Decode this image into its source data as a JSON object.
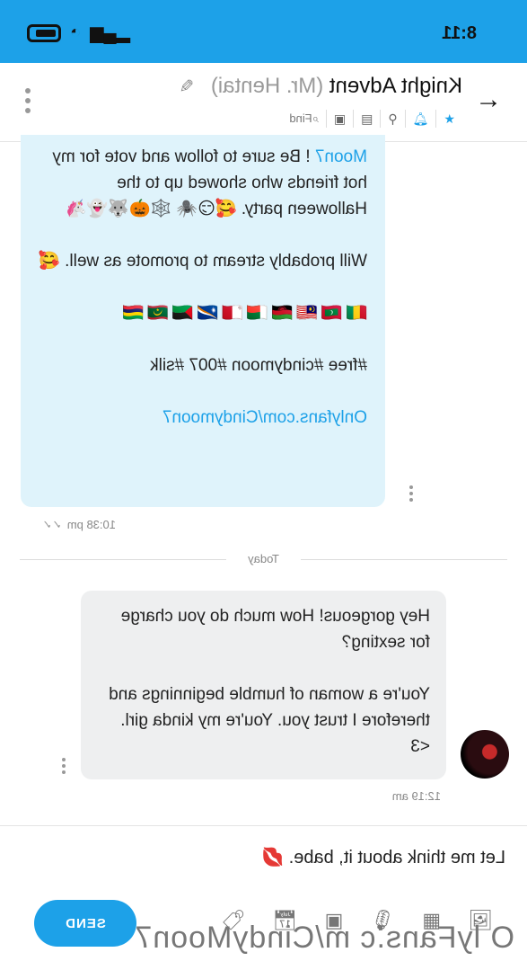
{
  "status": {
    "time": "8:11"
  },
  "header": {
    "title": "Knight Advent",
    "real_name": "(Mr. Hentai)",
    "find_label": "Find"
  },
  "messages": {
    "incoming": {
      "line1_link": "Moon7",
      "line1_rest": "! Be sure to follow and vote for my hot friends who showed up to the Halloween party. 🥰😏🕷️ 🕸️🎃🐺👻🦄",
      "para2": "Will probably stream to promote as well. 🥰",
      "flags": "🇬🇳🇲🇻🇲🇾🇲🇼🇲🇬🇲🇹🇲🇭🇲🇶🇲🇷🇲🇺",
      "tags": "#free #cindymoon #007 #silk",
      "link": "Onlyfans.com/Cindymoon7",
      "time": "10:38 pm"
    },
    "divider_label": "Today",
    "outgoing": {
      "para1": "Hey gorgeous! How much do you charge for sexting?",
      "para2": "You're a woman of humble beginnings and therefore I trust you. You're my kinda girl. <3",
      "time": "12:19 am"
    }
  },
  "composer": {
    "draft": "Let me think about it, babe. 💋",
    "send_label": "SEND"
  },
  "watermark": "O lyFans.c m/CindyMoon7",
  "colors": {
    "accent": "#1da1e8",
    "incoming_bg": "#dff3fb",
    "outgoing_bg": "#eeeff0"
  }
}
